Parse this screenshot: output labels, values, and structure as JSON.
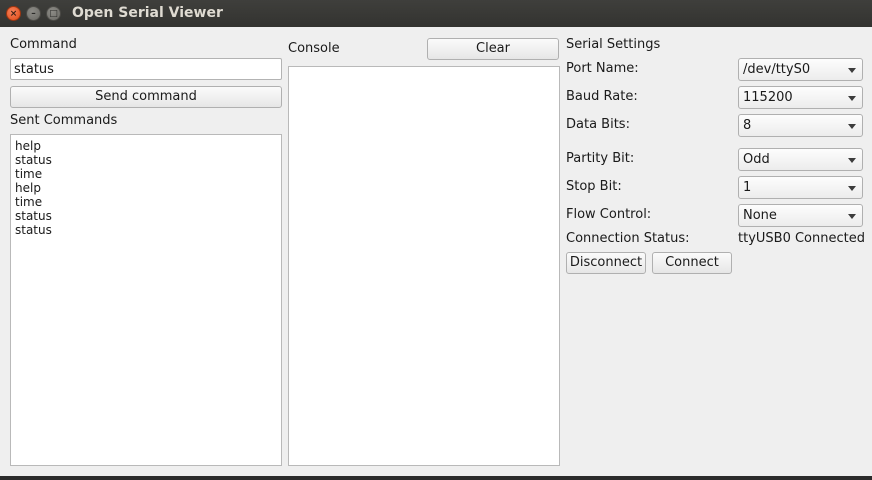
{
  "window": {
    "title": "Open Serial Viewer",
    "close_glyph": "×",
    "min_glyph": "–",
    "max_glyph": "□"
  },
  "command": {
    "label": "Command",
    "input_value": "status",
    "send_label": "Send command",
    "sent_label": "Sent Commands",
    "sent_items": [
      "help",
      "status",
      "time",
      "help",
      "time",
      "status",
      "status"
    ]
  },
  "console": {
    "label": "Console",
    "clear_label": "Clear"
  },
  "serial": {
    "section_label": "Serial Settings",
    "port_label": "Port Name:",
    "port_value": "/dev/ttyS0",
    "baud_label": "Baud Rate:",
    "baud_value": "115200",
    "databits_label": "Data Bits:",
    "databits_value": "8",
    "parity_label": "Partity Bit:",
    "parity_value": "Odd",
    "stopbit_label": "Stop Bit:",
    "stopbit_value": "1",
    "flow_label": "Flow Control:",
    "flow_value": "None",
    "status_label": "Connection Status:",
    "status_value": "ttyUSB0 Connected",
    "disconnect_label": "Disconnect",
    "connect_label": "Connect"
  }
}
